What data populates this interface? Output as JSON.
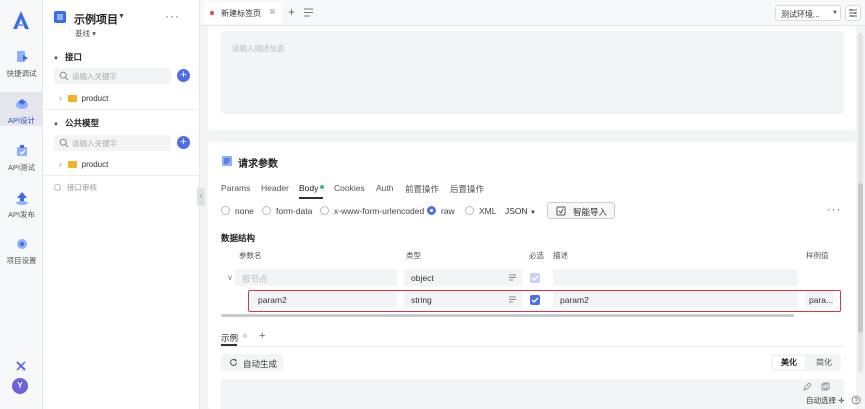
{
  "rail": {
    "items": [
      {
        "label": "快捷调试"
      },
      {
        "label": "API设计"
      },
      {
        "label": "API测试"
      },
      {
        "label": "API发布"
      },
      {
        "label": "项目设置"
      }
    ],
    "avatar": "Y"
  },
  "project": {
    "title": "示例项目",
    "branch": "基线",
    "interface_section": "接口",
    "interface_search_placeholder": "请输入关键字",
    "interface_folder": "product",
    "model_section": "公共模型",
    "model_search_placeholder": "请输入关键字",
    "model_folder": "product",
    "audit": "接口审核"
  },
  "tabs": {
    "current": "新建标签页"
  },
  "env": {
    "label": "测试环境..."
  },
  "description": {
    "placeholder": "请输入描述信息"
  },
  "request": {
    "title": "请求参数",
    "subtabs": [
      "Params",
      "Header",
      "Body",
      "Cookies",
      "Auth",
      "前置操作",
      "后置操作"
    ],
    "body_types": [
      "none",
      "form-data",
      "x-www-form-urlencoded",
      "raw",
      "XML"
    ],
    "selected_body_type": "raw",
    "format": "JSON",
    "smart_import": "智能导入",
    "structure_title": "数据结构",
    "columns": {
      "name": "参数名",
      "type": "类型",
      "required": "必选",
      "desc": "描述",
      "example": "样例值"
    },
    "rows": [
      {
        "name": "根节点",
        "type": "object",
        "required": true,
        "desc": "",
        "example": ""
      },
      {
        "name": "param2",
        "type": "string",
        "required": true,
        "desc": "param2",
        "example": "para..."
      }
    ]
  },
  "example": {
    "tab": "示例",
    "auto_generate": "自动生成",
    "beautify": "美化",
    "simplify": "简化"
  },
  "status": {
    "auto_select": "自动选择"
  },
  "colors": {
    "accent": "#4e6ee8",
    "highlight": "#e0353b",
    "tab_dot": "#e5483f",
    "body_dot": "#3cbd7a",
    "folder": "#f0b323"
  }
}
